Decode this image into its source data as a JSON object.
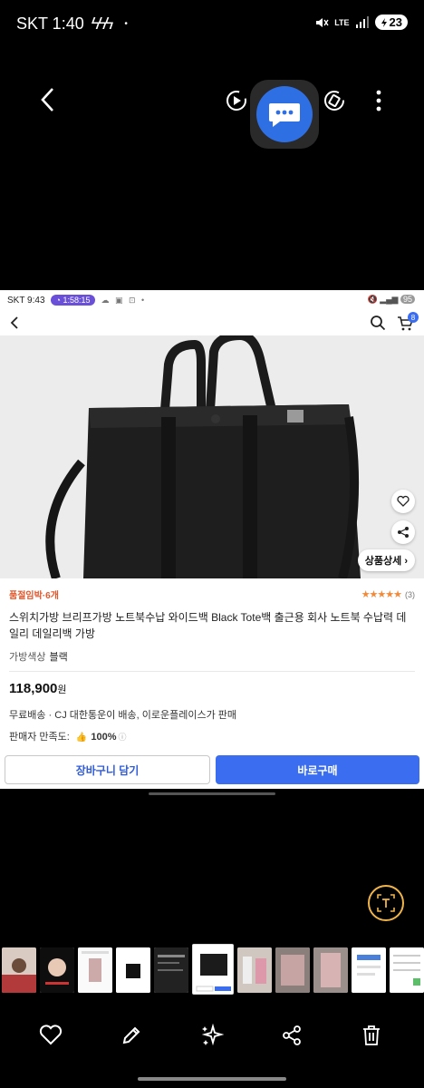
{
  "outer_status": {
    "carrier_time": "SKT 1:40",
    "bolts": "ϟϟϟ",
    "dot": "•",
    "network": "LTE",
    "battery": "23"
  },
  "inner_status": {
    "carrier_time": "SKT 9:43",
    "timer": "1:58:15",
    "battery": "95"
  },
  "header": {
    "cart_count": "8"
  },
  "product": {
    "detail_button": "상품상세",
    "deal_label": "품절임박·6개",
    "stars": "★★★★★",
    "review_count": "(3)",
    "title": "스위치가방 브리프가방 노트북수납 와이드백 Black Tote백 출근용 회사 노트북 수납력 데일리 데일리백 가방",
    "option_label": "가방색상",
    "option_value": "블랙",
    "price": "118,900",
    "price_unit": "원",
    "shipping": "무료배송 ·  CJ 대한통운이 배송, 이로운플레이스가 판매",
    "seller_label": "판매자 만족도:",
    "seller_value": "100%",
    "rating": 5
  },
  "actions": {
    "cart_label": "장바구니 담기",
    "buy_label": "바로구매"
  },
  "colors": {
    "accent": "#3a6df0",
    "deal": "#e2572b",
    "star": "#f08a3b",
    "timer": "#6a4fd8"
  }
}
